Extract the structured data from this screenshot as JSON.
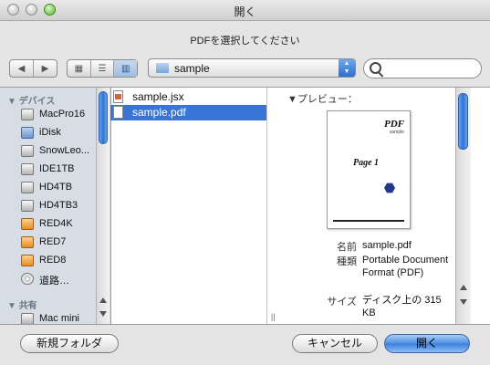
{
  "window": {
    "title": "開く"
  },
  "prompt": "PDFを選択してください",
  "toolbar": {
    "popup_label": "sample",
    "search_placeholder": ""
  },
  "sidebar": {
    "devices_header": "デバイス",
    "devices": [
      {
        "label": "MacPro16",
        "icon": "hard-drive-icon",
        "eject": false
      },
      {
        "label": "iDisk",
        "icon": "idisk-icon",
        "eject": false
      },
      {
        "label": "SnowLeo...",
        "icon": "hard-drive-icon",
        "eject": false
      },
      {
        "label": "IDE1TB",
        "icon": "hard-drive-icon",
        "eject": false
      },
      {
        "label": "HD4TB",
        "icon": "hard-drive-icon",
        "eject": false
      },
      {
        "label": "HD4TB3",
        "icon": "hard-drive-icon",
        "eject": false
      },
      {
        "label": "RED4K",
        "icon": "external-drive-icon",
        "eject": true
      },
      {
        "label": "RED7",
        "icon": "external-drive-icon",
        "eject": true
      },
      {
        "label": "RED8",
        "icon": "external-drive-icon",
        "eject": true
      },
      {
        "label": "道路…",
        "icon": "disc-icon",
        "eject": true
      }
    ],
    "shared_header": "共有",
    "shared": [
      {
        "label": "Mac mini",
        "icon": "computer-icon"
      }
    ]
  },
  "files": [
    {
      "name": "sample.jsx",
      "selected": false
    },
    {
      "name": "sample.pdf",
      "selected": true
    }
  ],
  "preview": {
    "header": "プレビュー：",
    "thumb": {
      "logo": "PDF",
      "logo_sub": "sample",
      "page_text": "Page 1"
    },
    "meta": [
      {
        "key": "名前",
        "value": "sample.pdf"
      },
      {
        "key": "種類",
        "value": "Portable Document Format (PDF)"
      },
      {
        "key": "サイズ",
        "value": "ディスク上の 315 KB"
      }
    ]
  },
  "buttons": {
    "new_folder": "新規フォルダ",
    "cancel": "キャンセル",
    "open": "開く"
  }
}
